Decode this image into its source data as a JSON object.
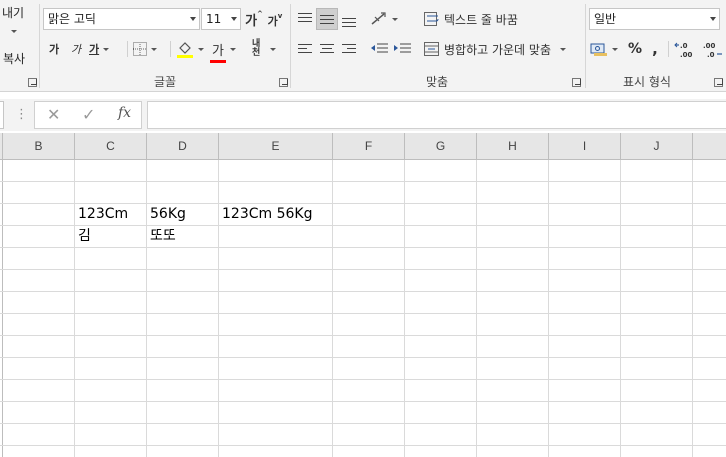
{
  "ribbon": {
    "clipboard": {
      "cut_label": "내기",
      "copy_label": "복사"
    },
    "font": {
      "name": "맑은 고딕",
      "size": "11",
      "grow_label": "가",
      "shrink_label": "가",
      "bold_label": "가",
      "italic_label": "가",
      "underline_label": "가",
      "phonetic_label": "내천",
      "color_label": "가",
      "group_label": "글꼴"
    },
    "alignment": {
      "wrap_label": "텍스트 줄 바꿈",
      "merge_label": "병합하고 가운데 맞춤",
      "group_label": "맞춤"
    },
    "number": {
      "format": "일반",
      "percent": "%",
      "comma": ",",
      "inc_decimal": "←.0 .00",
      "dec_decimal": ".00 →.0",
      "group_label": "표시 형식"
    },
    "colors": {
      "highlight": "#ffff00",
      "font_color": "#ff0000",
      "accent": "#217346"
    }
  },
  "formula_bar": {
    "cancel": "✕",
    "enter": "✓",
    "fx": "fx",
    "value": ""
  },
  "columns": [
    "B",
    "C",
    "D",
    "E",
    "F",
    "G",
    "H",
    "I",
    "J"
  ],
  "cells": {
    "c3": "123Cm",
    "d3": "56Kg",
    "e3": "123Cm 56Kg",
    "c4": "김",
    "d4": "또또"
  }
}
